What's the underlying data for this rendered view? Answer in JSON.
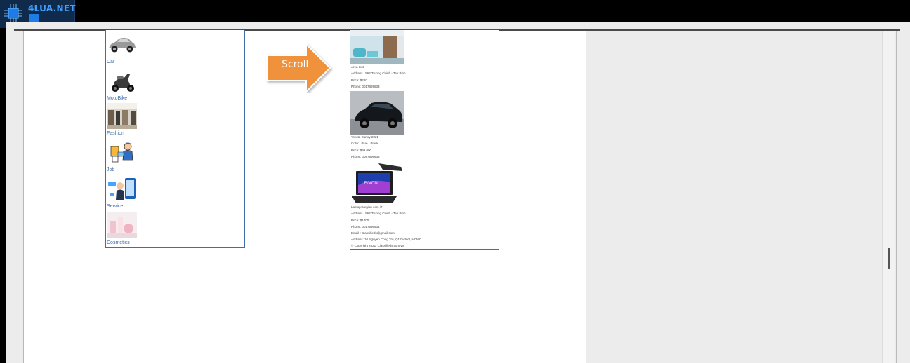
{
  "watermark": {
    "text": "4LUA.NET"
  },
  "categories": [
    {
      "label": "Car",
      "icon": "car-icon"
    },
    {
      "label": "MotoBike",
      "icon": "scooter-icon"
    },
    {
      "label": "Fashion",
      "icon": "store-icon"
    },
    {
      "label": "Job",
      "icon": "worker-icon"
    },
    {
      "label": "Service",
      "icon": "support-icon"
    },
    {
      "label": "Cosmetics",
      "icon": "cosmetics-icon"
    }
  ],
  "arrow": {
    "label": "Scroll"
  },
  "listings": [
    {
      "title": "Area 3x4",
      "address": "Address : 562 Truong Chinh - Tan Binh",
      "price": "Price: $220",
      "phone": "Phone: 0017899633"
    },
    {
      "title": "Toyota Camry 2021",
      "color": "Color : Blue - Black",
      "price": "Price: $99.000",
      "phone": "Phone: 0087896633"
    },
    {
      "title": "Laptop: Legion core i7",
      "address": "Address : 562 Truong Chinh - Tan Binh",
      "price": "Price: $1400",
      "phone": "Phone: 0017896531"
    }
  ],
  "footer": {
    "email": "Email : Classifieds@gmail.com",
    "address": "Address: 10 Nguyen Cong Tru, Q1 District, HCMC",
    "copyright": "© Copyright 2021. Classifieds.com.vn"
  }
}
